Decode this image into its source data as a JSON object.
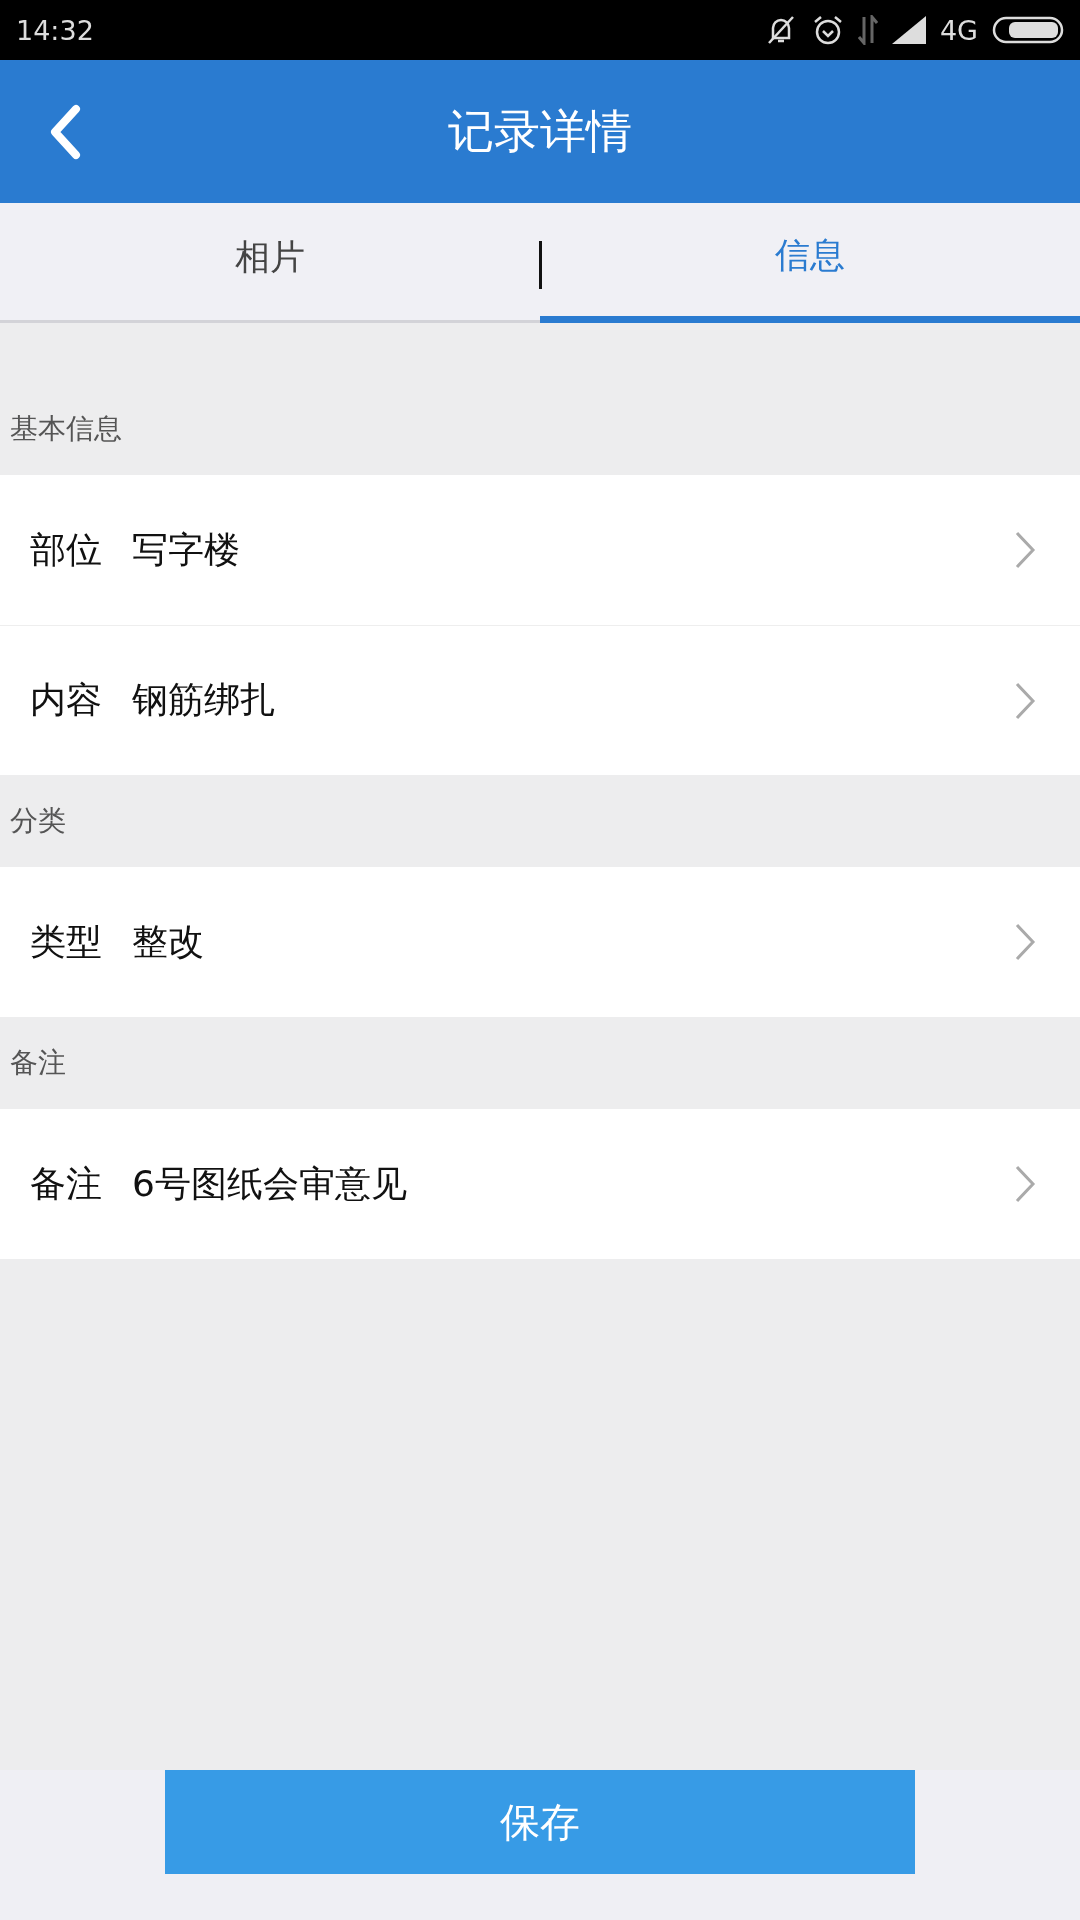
{
  "status_bar": {
    "time": "14:32",
    "network": "4G"
  },
  "header": {
    "title": "记录详情"
  },
  "tabs": [
    {
      "label": "相片",
      "selected": false
    },
    {
      "label": "信息",
      "selected": true
    }
  ],
  "sections": [
    {
      "title": "基本信息",
      "rows": [
        {
          "label": "部位",
          "value": "写字楼"
        },
        {
          "label": "内容",
          "value": "钢筋绑扎"
        }
      ]
    },
    {
      "title": "分类",
      "rows": [
        {
          "label": "类型",
          "value": "整改"
        }
      ]
    },
    {
      "title": "备注",
      "rows": [
        {
          "label": "备注",
          "value": "6号图纸会审意见"
        }
      ]
    }
  ],
  "save_button": {
    "label": "保存"
  }
}
